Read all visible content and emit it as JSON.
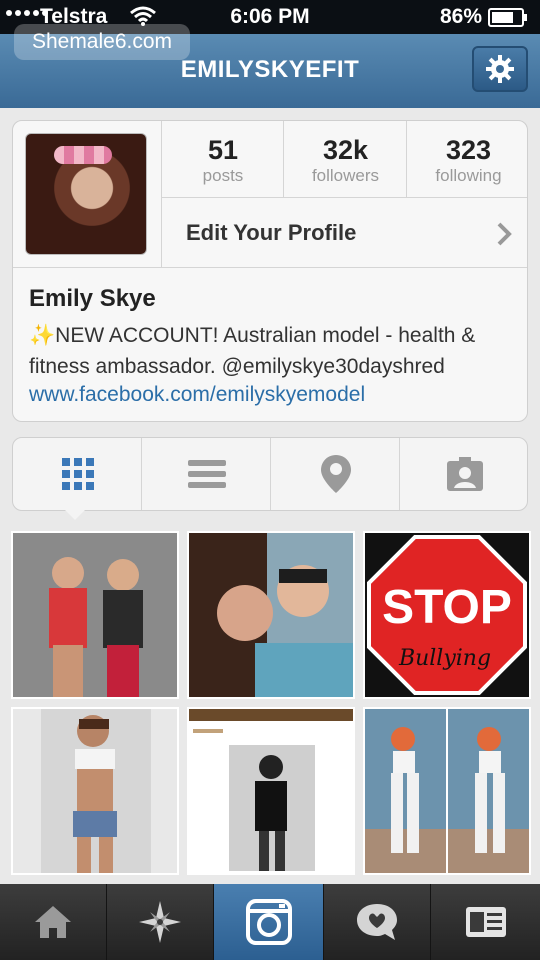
{
  "status_bar": {
    "carrier": "Telstra",
    "time": "6:06 PM",
    "battery": "86%",
    "battery_level": 0.86
  },
  "watermark": "Shemale6.com",
  "nav": {
    "title": "EMILYSKYEFIT",
    "settings_icon": "gear-icon"
  },
  "profile": {
    "stats": [
      {
        "value": "51",
        "label": "posts"
      },
      {
        "value": "32k",
        "label": "followers"
      },
      {
        "value": "323",
        "label": "following"
      }
    ],
    "edit_label": "Edit Your Profile",
    "name": "Emily Skye",
    "bio_sparkle": "✨",
    "bio": "NEW ACCOUNT! Australian model - health & fitness ambassador. @emilyskye30dayshred",
    "link": "www.facebook.com/emilyskyemodel"
  },
  "tabs": [
    {
      "name": "grid-view-icon",
      "active": true
    },
    {
      "name": "list-view-icon",
      "active": false
    },
    {
      "name": "map-pin-icon",
      "active": false
    },
    {
      "name": "tagged-photos-icon",
      "active": false
    }
  ],
  "photos": {
    "stop_text_line1": "STOP",
    "stop_text_line2": "Bullying"
  },
  "bottom_nav": [
    {
      "name": "home-icon"
    },
    {
      "name": "explore-icon"
    },
    {
      "name": "camera-icon",
      "active": true
    },
    {
      "name": "news-icon"
    },
    {
      "name": "profile-icon"
    }
  ],
  "colors": {
    "accent": "#3a6a96",
    "link": "#2b6ea8",
    "active_tab_icon": "#3b78b8"
  }
}
